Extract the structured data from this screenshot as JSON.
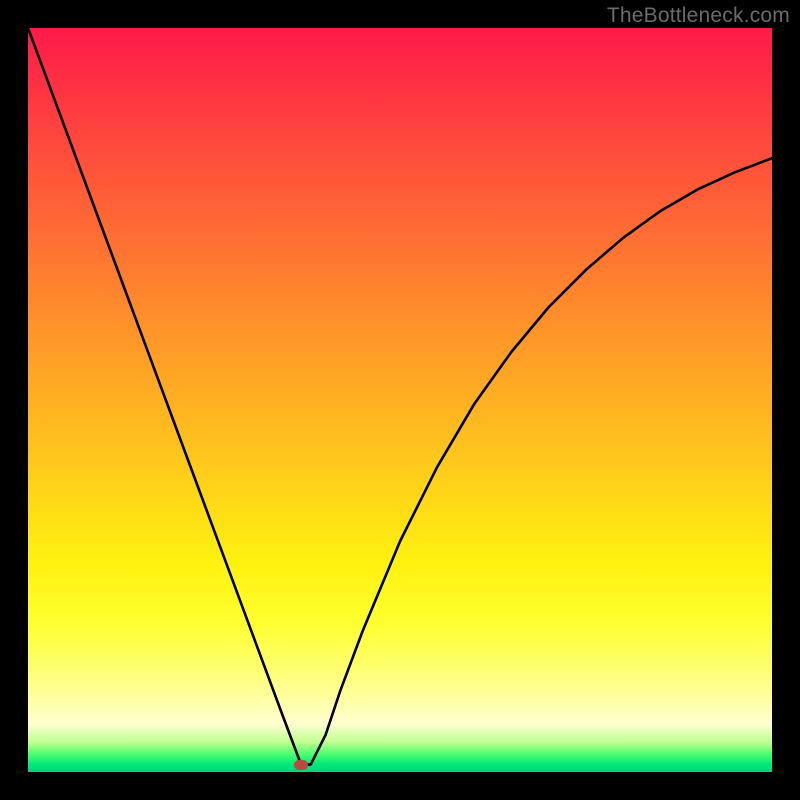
{
  "watermark": "TheBottleneck.com",
  "chart_data": {
    "type": "line",
    "title": "",
    "xlabel": "",
    "ylabel": "",
    "xlim": [
      0,
      100
    ],
    "ylim": [
      0,
      100
    ],
    "grid": false,
    "legend": false,
    "x": [
      0,
      5,
      10,
      15,
      20,
      25,
      28,
      30,
      32,
      34,
      35.5,
      36.7,
      38,
      40,
      42,
      45,
      50,
      55,
      60,
      65,
      70,
      75,
      80,
      85,
      90,
      95,
      100
    ],
    "y": [
      100,
      86.5,
      73,
      59.5,
      46,
      32.5,
      24.4,
      19,
      13.6,
      8.2,
      4.2,
      1,
      1,
      5,
      11,
      19,
      31,
      41,
      49.5,
      56.5,
      62.5,
      67.5,
      71.8,
      75.4,
      78.3,
      80.6,
      82.5
    ],
    "marker": {
      "x": 36.7,
      "y": 1
    },
    "background_gradient": {
      "type": "vertical",
      "stops": [
        {
          "pos": 0,
          "color": "#ff1a4a"
        },
        {
          "pos": 50,
          "color": "#ffb620"
        },
        {
          "pos": 80,
          "color": "#ffff30"
        },
        {
          "pos": 100,
          "color": "#00d080"
        }
      ]
    }
  }
}
